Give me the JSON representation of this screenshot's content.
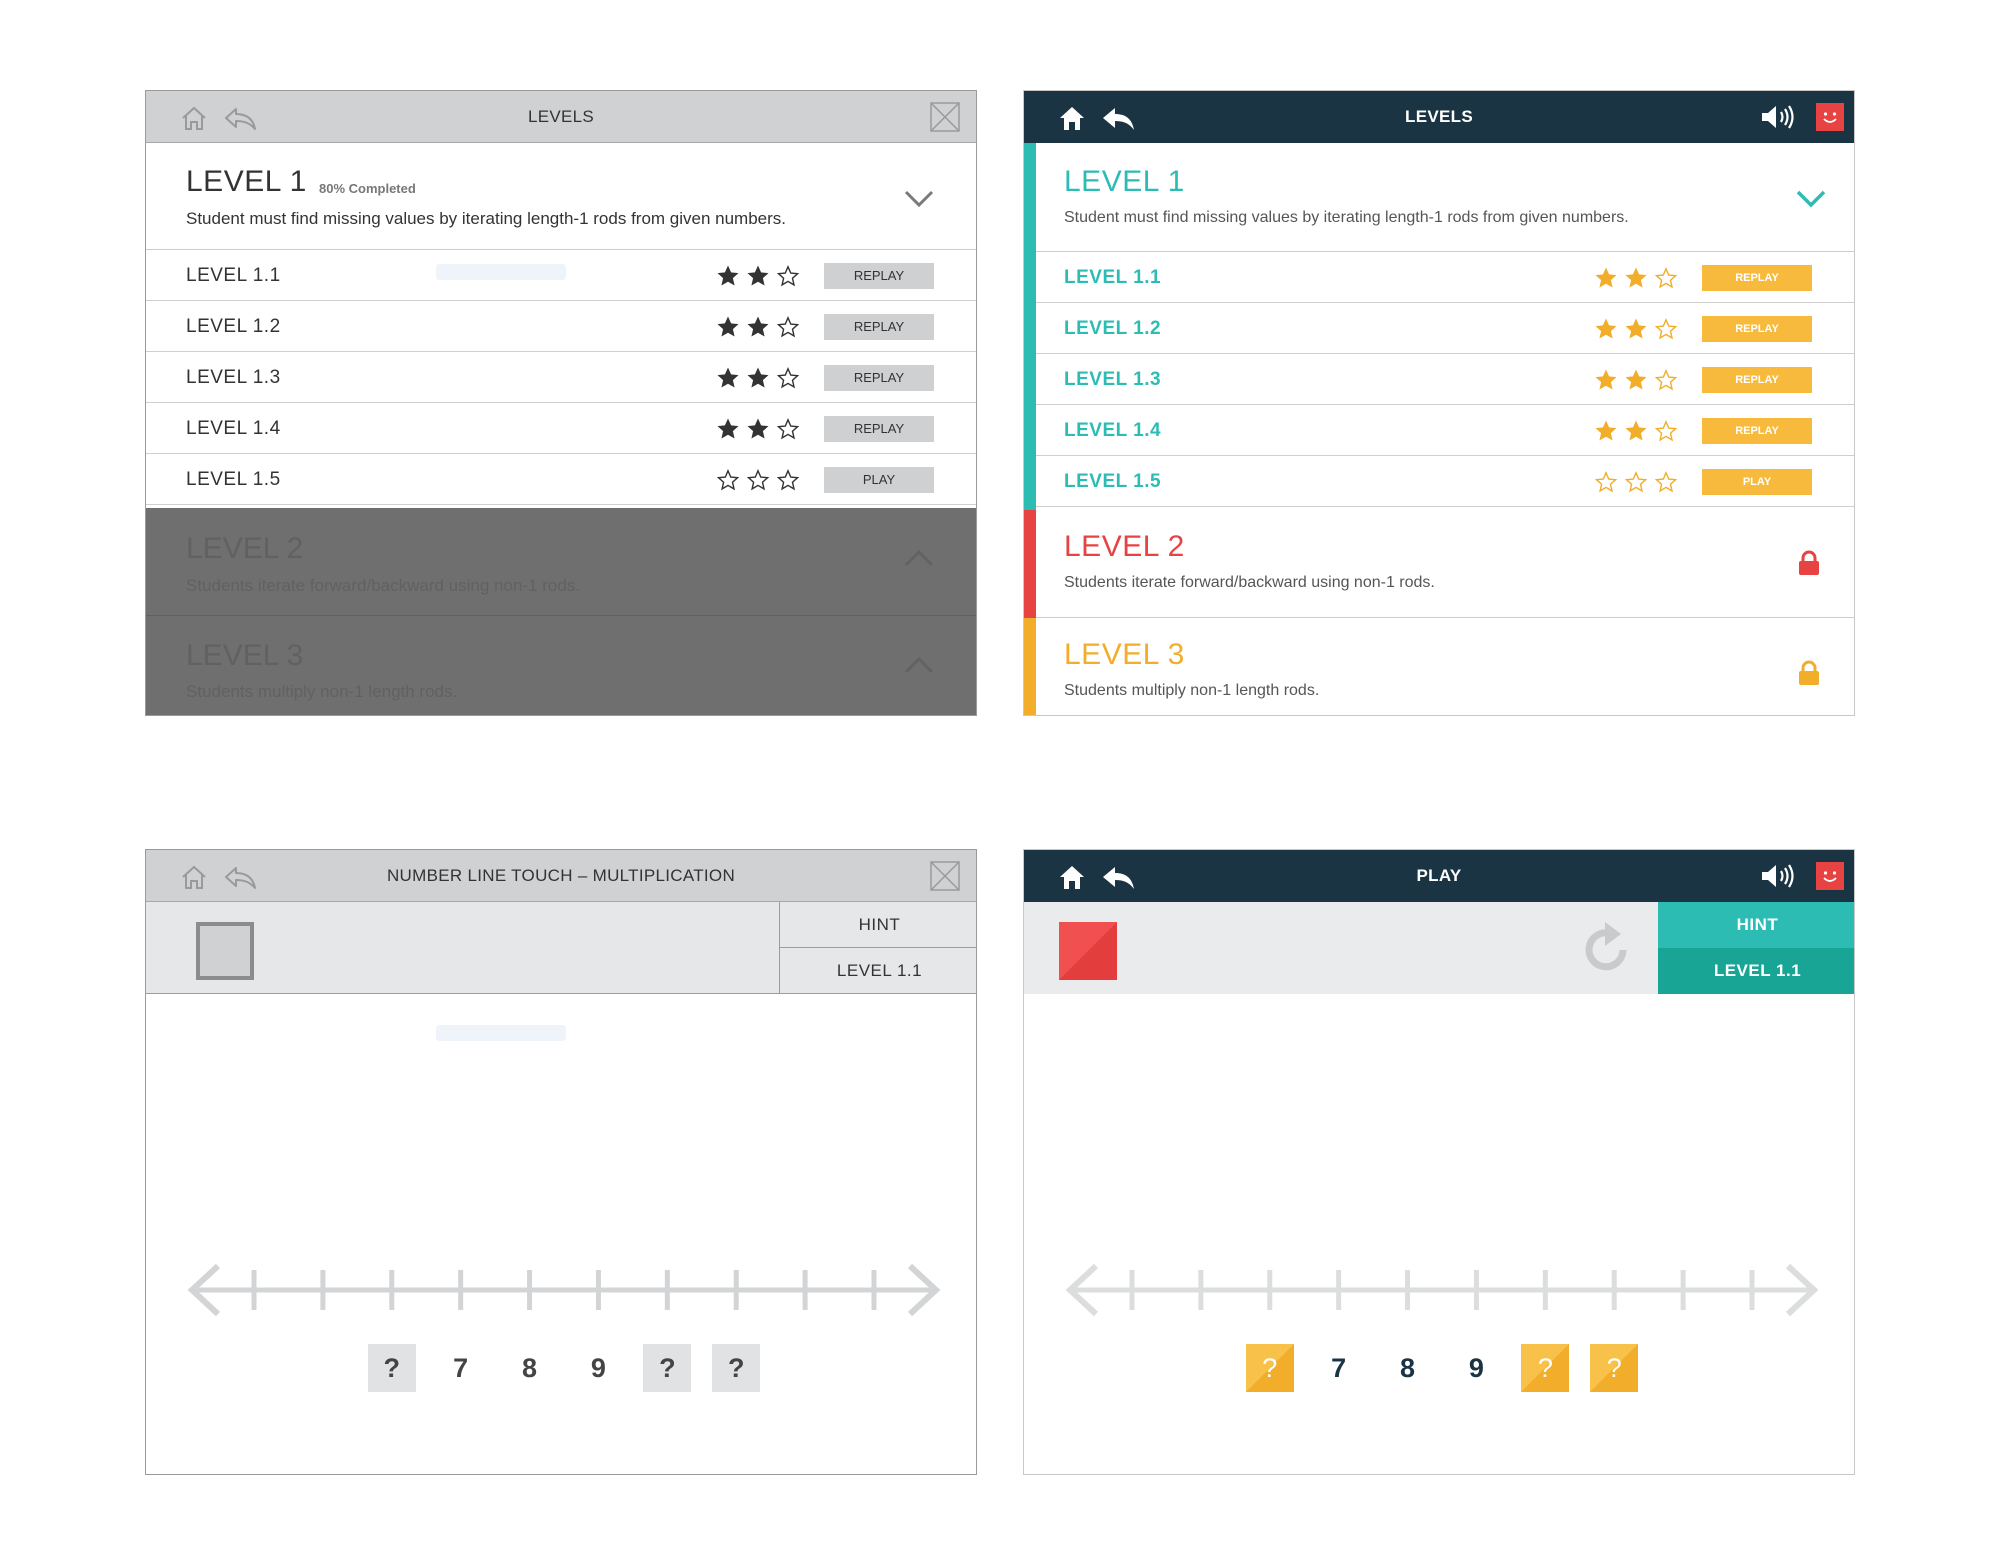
{
  "colors": {
    "dark_bar": "#1b3443",
    "teal": "#2dbcb4",
    "teal_dark": "#19a596",
    "red": "#e84343",
    "orange": "#f2ad2a",
    "star_gold": "#f2ad2a",
    "wire_gray": "#d0d1d3"
  },
  "wireframe_levels": {
    "title": "LEVELS",
    "icons": [
      "home-icon",
      "back-icon",
      "close-icon"
    ],
    "level1": {
      "title": "LEVEL 1",
      "progress": "80% Completed",
      "description": "Student must find missing values by iterating length-1 rods from given numbers."
    },
    "rows": [
      {
        "label": "LEVEL 1.1",
        "stars": 2,
        "button": "REPLAY"
      },
      {
        "label": "LEVEL 1.2",
        "stars": 2,
        "button": "REPLAY"
      },
      {
        "label": "LEVEL 1.3",
        "stars": 2,
        "button": "REPLAY"
      },
      {
        "label": "LEVEL 1.4",
        "stars": 2,
        "button": "REPLAY"
      },
      {
        "label": "LEVEL 1.5",
        "stars": 0,
        "button": "PLAY"
      }
    ],
    "level2": {
      "title": "LEVEL 2",
      "description": "Students iterate forward/backward using non-1 rods."
    },
    "level3": {
      "title": "LEVEL 3",
      "description": "Students multiply non-1 length rods."
    }
  },
  "color_levels": {
    "title": "LEVELS",
    "icons": [
      "home-icon",
      "back-icon",
      "speaker-icon",
      "smiley-icon"
    ],
    "level1": {
      "title": "LEVEL 1",
      "description": "Student must find missing values by iterating length-1 rods from given numbers."
    },
    "rows": [
      {
        "label": "LEVEL 1.1",
        "stars": 2,
        "button": "REPLAY"
      },
      {
        "label": "LEVEL 1.2",
        "stars": 2,
        "button": "REPLAY"
      },
      {
        "label": "LEVEL 1.3",
        "stars": 2,
        "button": "REPLAY"
      },
      {
        "label": "LEVEL 1.4",
        "stars": 2,
        "button": "REPLAY"
      },
      {
        "label": "LEVEL 1.5",
        "stars": 0,
        "button": "PLAY"
      }
    ],
    "level2": {
      "title": "LEVEL 2",
      "description": "Students iterate forward/backward using non-1 rods.",
      "locked": true
    },
    "level3": {
      "title": "LEVEL 3",
      "description": "Students multiply non-1 length rods.",
      "locked": true
    }
  },
  "wireframe_game": {
    "title": "NUMBER LINE TOUCH – MULTIPLICATION",
    "hint": "HINT",
    "level": "LEVEL 1.1",
    "tiles": [
      "?",
      "7",
      "8",
      "9",
      "?",
      "?"
    ],
    "tick_count": 10
  },
  "color_game": {
    "title": "PLAY",
    "hint": "HINT",
    "level": "LEVEL 1.1",
    "tiles": [
      "?",
      "7",
      "8",
      "9",
      "?",
      "?"
    ],
    "tick_count": 10
  }
}
